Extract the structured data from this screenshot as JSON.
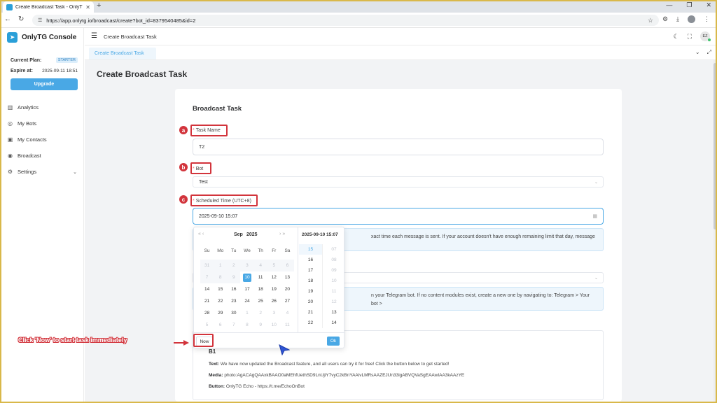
{
  "browser": {
    "tab_title": "Create Broadcast Task - OnlyTG C",
    "url": "https://app.onlytg.io/broadcast/create?bot_id=8379540485&id=2"
  },
  "sidebar": {
    "brand": "OnlyTG Console",
    "plan_label": "Current Plan:",
    "plan_value": "STARTER",
    "expire_label": "Expire at:",
    "expire_value": "2025-09-11 18:51",
    "upgrade_label": "Upgrade",
    "items": [
      {
        "label": "Analytics",
        "icon": "chart-icon"
      },
      {
        "label": "My Bots",
        "icon": "bot-icon"
      },
      {
        "label": "My Contacts",
        "icon": "contacts-icon"
      },
      {
        "label": "Broadcast",
        "icon": "broadcast-icon"
      },
      {
        "label": "Settings",
        "icon": "gear-icon"
      }
    ]
  },
  "header": {
    "breadcrumb": "Create Broadcast Task",
    "avatar_initials": "EZ",
    "tab_label": "Create Broadcast Task"
  },
  "main": {
    "page_title": "Create Broadcast Task",
    "card_title": "Broadcast Task",
    "task_name_label": "Task Name",
    "task_name_value": "T2",
    "bot_label": "Bot",
    "bot_value": "Test",
    "time_label": "Scheduled Time (UTC+8)",
    "time_value": "2025-09-10 15:07",
    "info1_text": "xact time each message is sent. If your account doesn't have enough remaining limit that day, message",
    "info2_text": "n your Telegram bot. If no content modules exist, create a new one by navigating to: Telegram > Your bot >",
    "content": {
      "name": "B1",
      "text_label": "Text:",
      "text_value": "We have now updated the Broadcast feature, and all users can try it for free! Click the button below to get started!",
      "media_label": "Media:",
      "media_value": "photo:AgACAgQAAxkBAAO0aMEhfUethSD9LnUjiY7vyC2kBnYAAlvLMRsAAZEJUn33igABVQVaSgEAAwIAA3kAAzYE",
      "button_label": "Button:",
      "button_value": "OnlyTG Echo - https://t.me/EchoOnBot"
    }
  },
  "picker": {
    "month": "Sep",
    "year": "2025",
    "time_header": "2025-09-10 15:07",
    "weekdays": [
      "Su",
      "Mo",
      "Tu",
      "We",
      "Th",
      "Fr",
      "Sa"
    ],
    "days": [
      "31",
      "1",
      "2",
      "3",
      "4",
      "5",
      "6",
      "7",
      "8",
      "9",
      "10",
      "11",
      "12",
      "13",
      "14",
      "15",
      "16",
      "17",
      "18",
      "19",
      "20",
      "21",
      "22",
      "23",
      "24",
      "25",
      "26",
      "27",
      "28",
      "29",
      "30",
      "1",
      "2",
      "3",
      "4",
      "5",
      "6",
      "7",
      "8",
      "9",
      "10",
      "11"
    ],
    "selected_day": "10",
    "hours": [
      "15",
      "16",
      "17",
      "18",
      "19",
      "20",
      "21",
      "22"
    ],
    "minutes": [
      "07",
      "08",
      "09",
      "10",
      "11",
      "12",
      "13",
      "14"
    ],
    "now_label": "Now",
    "ok_label": "Ok"
  },
  "annotations": {
    "a": "a",
    "b": "b",
    "c": "c",
    "callout": "Click 'Now' to start task immediately",
    "color": "#d2343c"
  }
}
